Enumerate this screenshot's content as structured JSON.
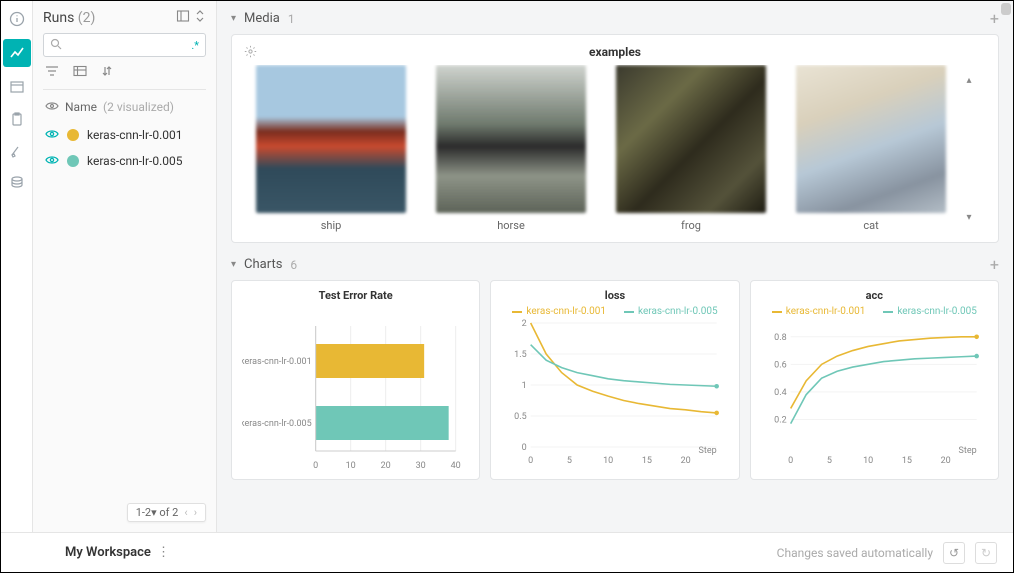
{
  "sidebar": {
    "title": "Runs",
    "count": "(2)",
    "column_header": "Name",
    "column_sub": "(2 visualized)",
    "pager_text": "1-2▾ of 2",
    "runs": [
      {
        "name": "keras-cnn-lr-0.001",
        "color": "#e8b834"
      },
      {
        "name": "keras-cnn-lr-0.005",
        "color": "#6fc7b7"
      }
    ]
  },
  "media": {
    "section_title": "Media",
    "section_count": "1",
    "panel_title": "examples",
    "thumbs": [
      {
        "label": "ship"
      },
      {
        "label": "horse"
      },
      {
        "label": "frog"
      },
      {
        "label": "cat"
      }
    ]
  },
  "charts": {
    "section_title": "Charts",
    "section_count": "6",
    "legend": [
      {
        "name": "keras-cnn-lr-0.001",
        "color": "#e8b834"
      },
      {
        "name": "keras-cnn-lr-0.005",
        "color": "#6fc7b7"
      }
    ]
  },
  "footer": {
    "workspace": "My Workspace",
    "status": "Changes saved automatically"
  },
  "chart_data": [
    {
      "type": "bar",
      "title": "Test Error Rate",
      "categories": [
        "keras-cnn-lr-0.001",
        "keras-cnn-lr-0.005"
      ],
      "values": [
        31,
        38
      ],
      "colors": [
        "#e8b834",
        "#6fc7b7"
      ],
      "xlim": [
        0,
        40
      ],
      "xticks": [
        0,
        10,
        20,
        30,
        40
      ],
      "orientation": "horizontal"
    },
    {
      "type": "line",
      "title": "loss",
      "xlabel": "Step",
      "x": [
        0,
        2,
        4,
        6,
        8,
        10,
        12,
        14,
        16,
        18,
        20,
        22,
        24
      ],
      "series": [
        {
          "name": "keras-cnn-lr-0.001",
          "color": "#e8b834",
          "values": [
            2.0,
            1.5,
            1.2,
            1.0,
            0.9,
            0.82,
            0.75,
            0.7,
            0.66,
            0.62,
            0.6,
            0.57,
            0.55
          ]
        },
        {
          "name": "keras-cnn-lr-0.005",
          "color": "#6fc7b7",
          "values": [
            1.65,
            1.4,
            1.28,
            1.2,
            1.15,
            1.1,
            1.07,
            1.05,
            1.03,
            1.01,
            1.0,
            0.99,
            0.98
          ]
        }
      ],
      "xlim": [
        0,
        24
      ],
      "ylim": [
        0,
        2
      ],
      "xticks": [
        0,
        5,
        10,
        15,
        20
      ],
      "yticks": [
        0,
        0.5,
        1,
        1.5,
        2
      ]
    },
    {
      "type": "line",
      "title": "acc",
      "xlabel": "Step",
      "x": [
        0,
        2,
        4,
        6,
        8,
        10,
        12,
        14,
        16,
        18,
        20,
        22,
        24
      ],
      "series": [
        {
          "name": "keras-cnn-lr-0.001",
          "color": "#e8b834",
          "values": [
            0.28,
            0.48,
            0.6,
            0.66,
            0.7,
            0.73,
            0.75,
            0.77,
            0.78,
            0.79,
            0.795,
            0.8,
            0.8
          ]
        },
        {
          "name": "keras-cnn-lr-0.005",
          "color": "#6fc7b7",
          "values": [
            0.17,
            0.38,
            0.5,
            0.55,
            0.58,
            0.6,
            0.62,
            0.63,
            0.64,
            0.645,
            0.65,
            0.655,
            0.66
          ]
        }
      ],
      "xlim": [
        0,
        24
      ],
      "ylim": [
        0,
        0.9
      ],
      "xticks": [
        0,
        5,
        10,
        15,
        20
      ],
      "yticks": [
        0.2,
        0.4,
        0.6,
        0.8
      ]
    }
  ]
}
